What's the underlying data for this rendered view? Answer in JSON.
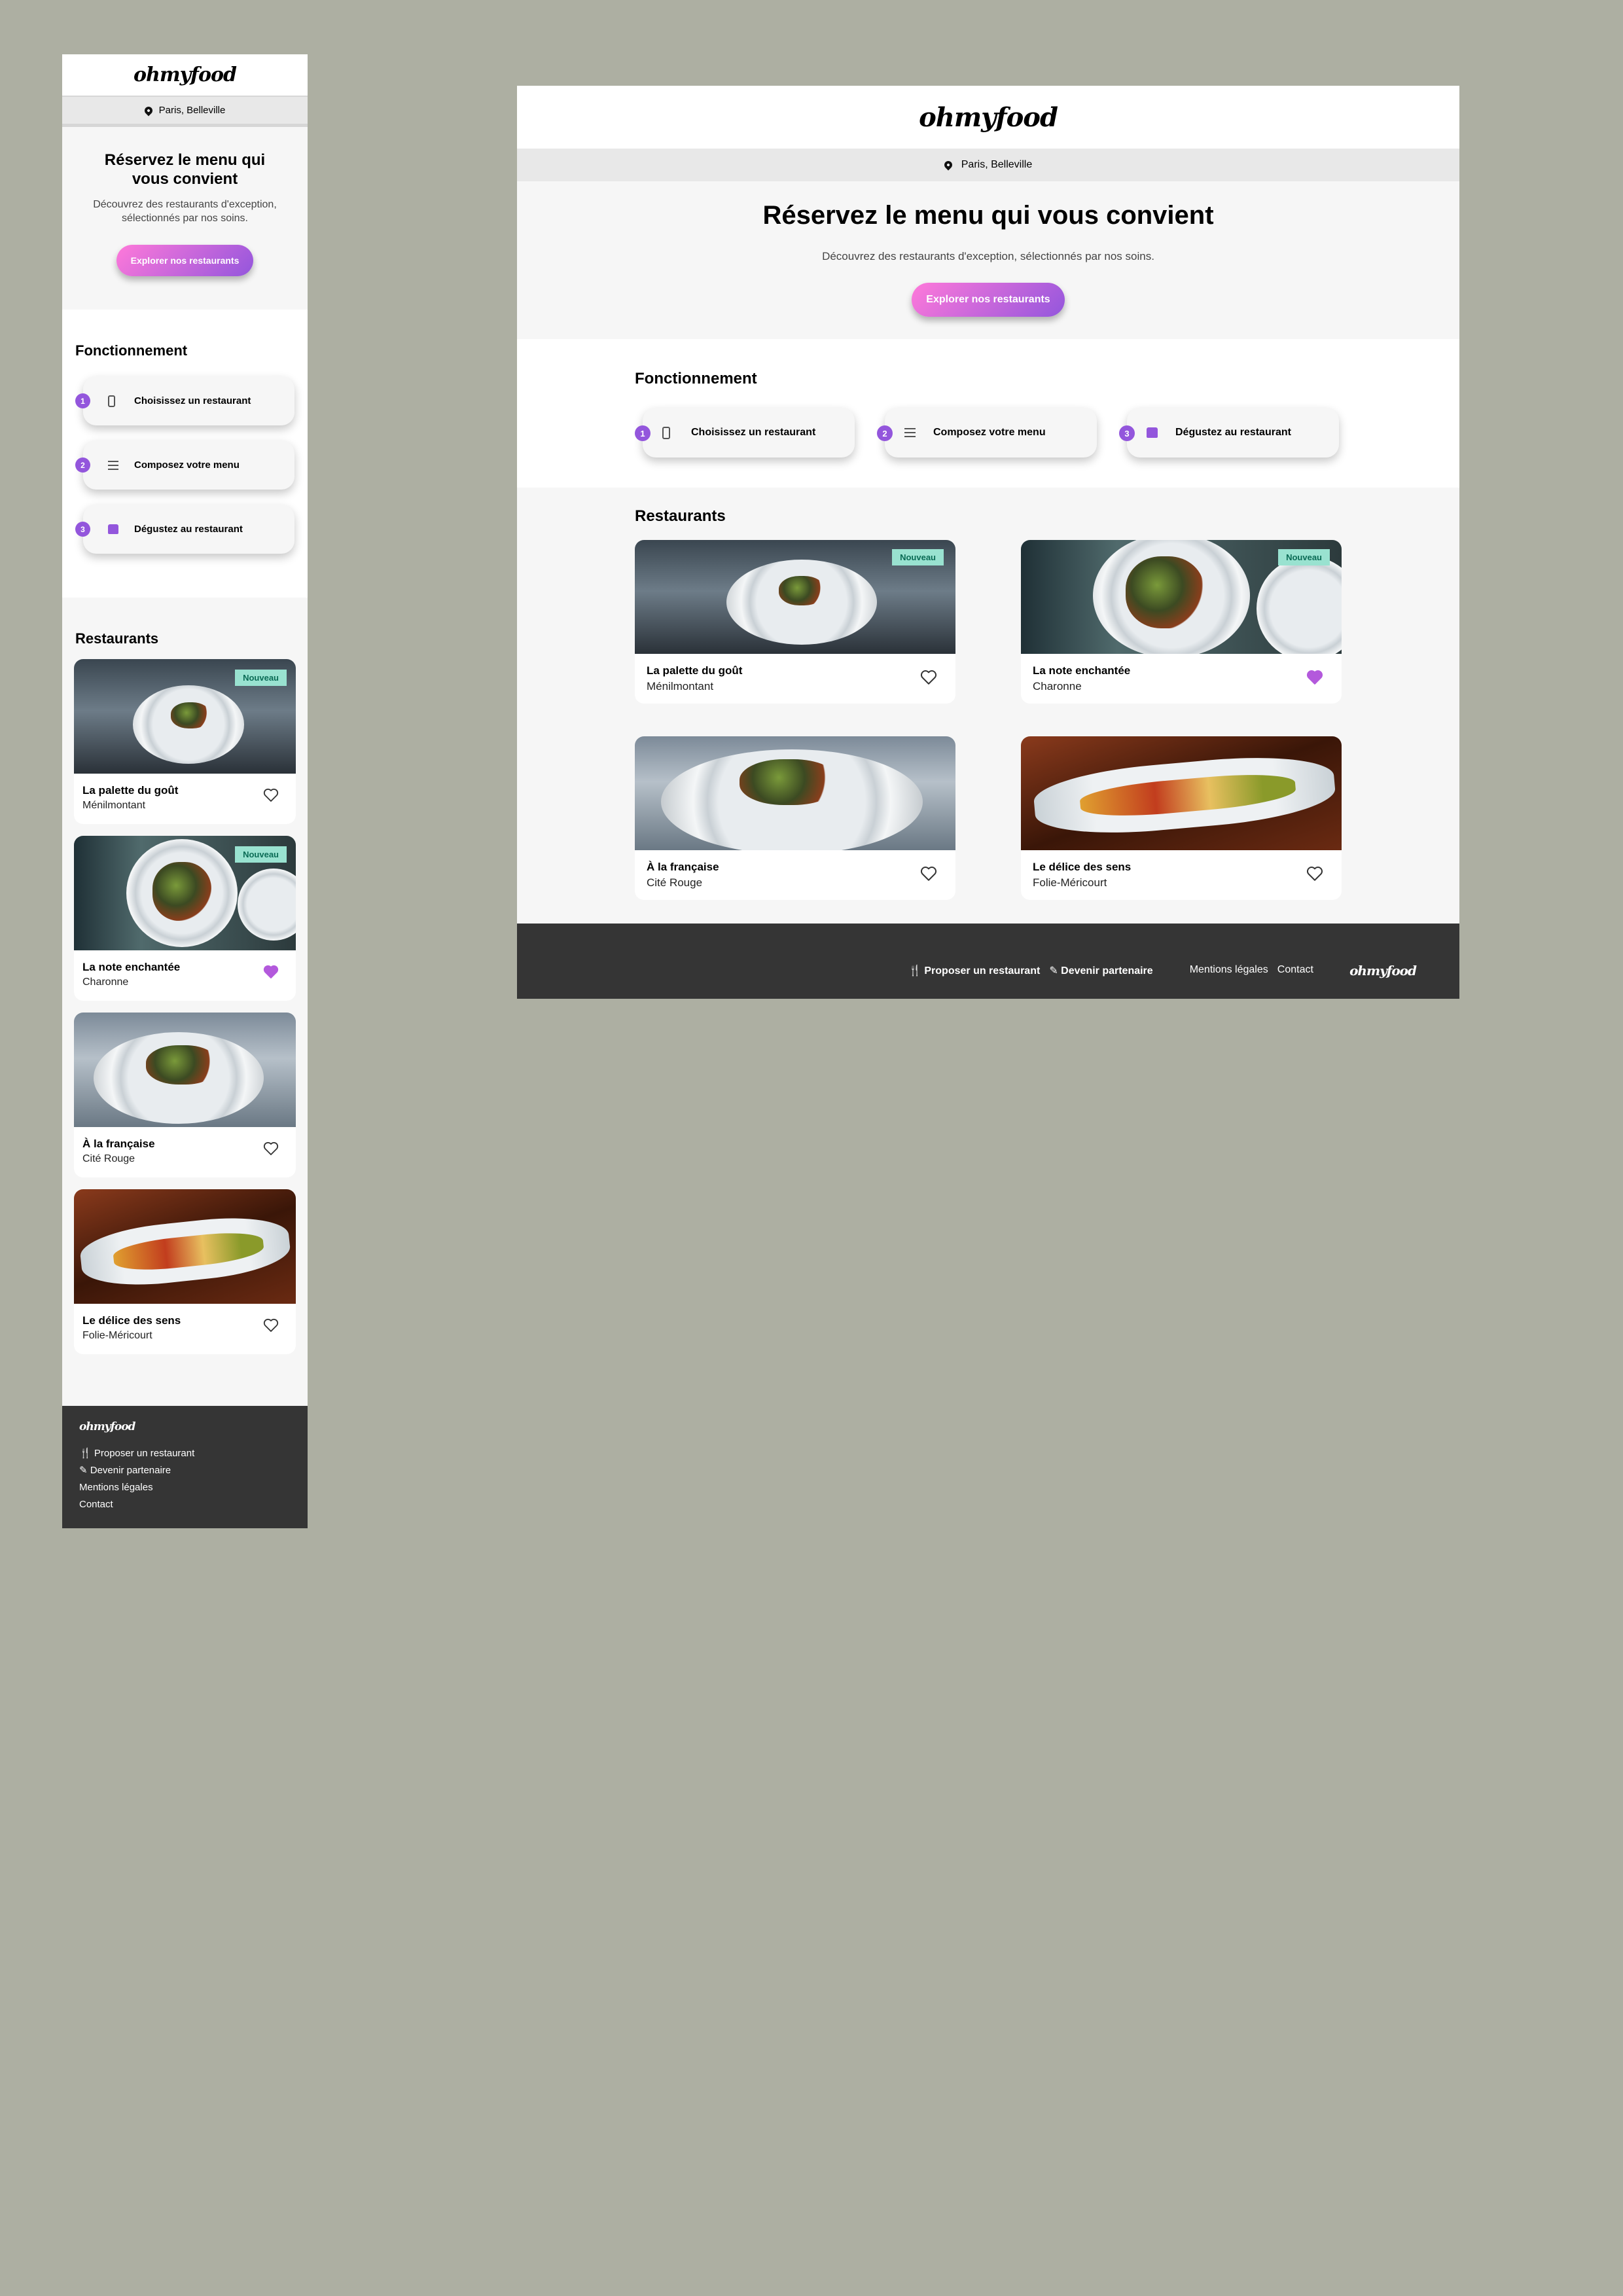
{
  "brand": {
    "logo": "ohmyfood",
    "accent": "#9356dc",
    "accent_light": "#ff79da",
    "badge_bg": "#99e2d0",
    "footer_bg": "#353535"
  },
  "location": {
    "icon": "map-pin-icon",
    "text": "Paris, Belleville"
  },
  "hero": {
    "title": "Réservez le menu qui vous convient",
    "subtitle": "Découvrez des restaurants d'exception, sélectionnés par nos soins.",
    "cta": "Explorer nos restaurants"
  },
  "how": {
    "title": "Fonctionnement",
    "steps": [
      {
        "number": "1",
        "icon": "smartphone-icon",
        "label": "Choisissez un restaurant"
      },
      {
        "number": "2",
        "icon": "list-icon",
        "label": "Composez votre menu"
      },
      {
        "number": "3",
        "icon": "store-icon",
        "label": "Dégustez au restaurant"
      }
    ]
  },
  "restaurants": {
    "title": "Restaurants",
    "badge": "Nouveau",
    "items": [
      {
        "name": "La palette du goût",
        "area": "Ménilmontant",
        "new": true,
        "liked": false
      },
      {
        "name": "La note enchantée",
        "area": "Charonne",
        "new": true,
        "liked": true
      },
      {
        "name": "À la française",
        "area": "Cité Rouge",
        "new": false,
        "liked": false
      },
      {
        "name": "Le délice des sens",
        "area": "Folie-Méricourt",
        "new": false,
        "liked": false
      }
    ]
  },
  "footer": {
    "logo": "ohmyfood",
    "propose": {
      "icon": "utensils-icon",
      "label": "Proposer un restaurant"
    },
    "partner": {
      "icon": "handshake-icon",
      "label": "Devenir partenaire"
    },
    "legal": "Mentions légales",
    "contact": "Contact"
  }
}
